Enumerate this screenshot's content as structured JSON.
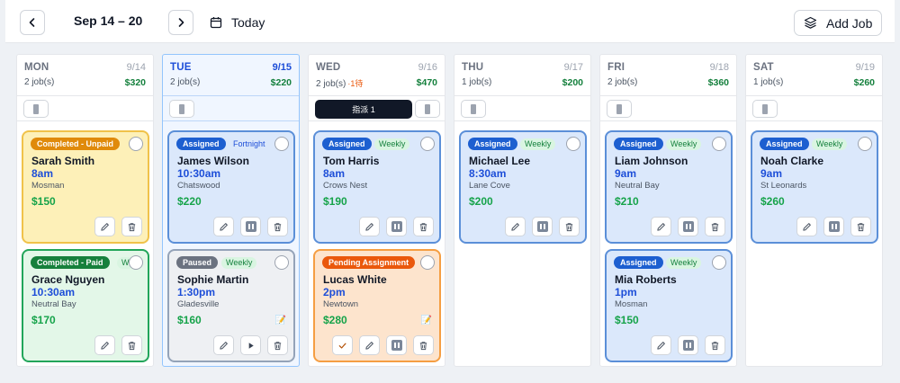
{
  "header": {
    "range": "Sep 14 – 20",
    "today_label": "Today",
    "add_job_label": "Add Job"
  },
  "days": [
    {
      "dow": "MON",
      "date": "9/14",
      "jobs": "2 job(s)",
      "total": "$320"
    },
    {
      "dow": "TUE",
      "date": "9/15",
      "jobs": "2 job(s)",
      "total": "$220"
    },
    {
      "dow": "WED",
      "date": "9/16",
      "jobs": "2 job(s)",
      "pending": "·1待",
      "total": "$470",
      "dispatch": "指派 1"
    },
    {
      "dow": "THU",
      "date": "9/17",
      "jobs": "1 job(s)",
      "total": "$200"
    },
    {
      "dow": "FRI",
      "date": "9/18",
      "jobs": "2 job(s)",
      "total": "$360"
    },
    {
      "dow": "SAT",
      "date": "9/19",
      "jobs": "1 job(s)",
      "total": "$260"
    }
  ],
  "jobs": {
    "mon1": {
      "status": "Completed - Unpaid",
      "name": "Sarah Smith",
      "time": "8am",
      "suburb": "Mosman",
      "price": "$150"
    },
    "mon2": {
      "status": "Completed - Paid",
      "freq": "W",
      "name": "Grace Nguyen",
      "time": "10:30am",
      "suburb": "Neutral Bay",
      "price": "$170"
    },
    "tue1": {
      "status": "Assigned",
      "freq": "Fortnight",
      "name": "James Wilson",
      "time": "10:30am",
      "suburb": "Chatswood",
      "price": "$220"
    },
    "tue2": {
      "status": "Paused",
      "freq": "Weekly",
      "name": "Sophie Martin",
      "time": "1:30pm",
      "suburb": "Gladesville",
      "price": "$160"
    },
    "wed1": {
      "status": "Assigned",
      "freq": "Weekly",
      "name": "Tom Harris",
      "time": "8am",
      "suburb": "Crows Nest",
      "price": "$190"
    },
    "wed2": {
      "status": "Pending Assignment",
      "name": "Lucas White",
      "time": "2pm",
      "suburb": "Newtown",
      "price": "$280"
    },
    "thu1": {
      "status": "Assigned",
      "freq": "Weekly",
      "name": "Michael Lee",
      "time": "8:30am",
      "suburb": "Lane Cove",
      "price": "$200"
    },
    "fri1": {
      "status": "Assigned",
      "freq": "Weekly",
      "name": "Liam Johnson",
      "time": "9am",
      "suburb": "Neutral Bay",
      "price": "$210"
    },
    "fri2": {
      "status": "Assigned",
      "freq": "Weekly",
      "name": "Mia Roberts",
      "time": "1pm",
      "suburb": "Mosman",
      "price": "$150"
    },
    "sat1": {
      "status": "Assigned",
      "freq": "Weekly",
      "name": "Noah Clarke",
      "time": "9am",
      "suburb": "St Leonards",
      "price": "$260"
    }
  },
  "icons": {
    "prev": "chevron-left-icon",
    "next": "chevron-right-icon",
    "today": "calendar-icon",
    "add": "layers-icon",
    "edit": "pencil-icon",
    "pause": "pause-icon",
    "play": "play-icon",
    "delete": "trash-icon",
    "confirm": "check-icon",
    "note": "note-icon"
  },
  "colors": {
    "assigned": "#1d5fd0",
    "paused": "#6b7280",
    "pending": "#ea580c",
    "unpaid": "#e08a0b",
    "paid": "#16803c",
    "price": "#16a34a"
  }
}
